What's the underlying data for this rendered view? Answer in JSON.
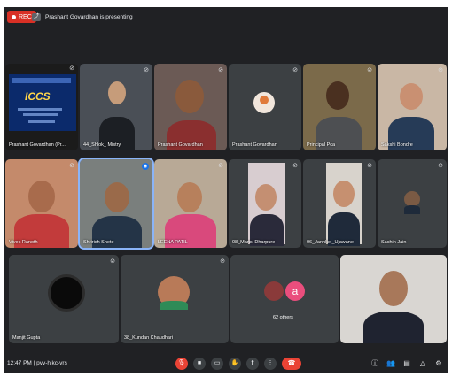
{
  "topbar": {
    "rec_label": "REC",
    "presenting_text": "Prashant Govardhan is presenting"
  },
  "tiles": {
    "presentation": {
      "name": "Prashant Govardhan (Pr..."
    },
    "t2": {
      "name": "44_Shlok_ Mistry"
    },
    "t3": {
      "name": "Prashant Govardhan"
    },
    "t4": {
      "name": "Prashant Govardhan"
    },
    "t5": {
      "name": "Principal Pca"
    },
    "t6": {
      "name": "Sakshi Bondre"
    },
    "t7": {
      "name": "Vivek Ranoth"
    },
    "t8": {
      "name": "Shrirish Shete"
    },
    "t9": {
      "name": "LEENA PATIL"
    },
    "t10": {
      "name": "08_Mansi Dharpure"
    },
    "t11": {
      "name": "06_Janhke _Ujawane"
    },
    "t12": {
      "name": "Sachin Jain"
    },
    "t13": {
      "name": "Manjit Gupta"
    },
    "t14": {
      "name": "38_Kundan Chaudhari"
    },
    "t15": {
      "others_label": "62 others",
      "avatar_letter": "a"
    }
  },
  "slide": {
    "logo_text": "ICCS"
  },
  "bottombar": {
    "time": "12:47 PM",
    "separator": "|",
    "meeting_code": "pvv-hikc-vrs"
  },
  "colors": {
    "background": "#202124",
    "tile": "#3c4043",
    "danger": "#ea4335",
    "active": "#8ab4f8"
  }
}
